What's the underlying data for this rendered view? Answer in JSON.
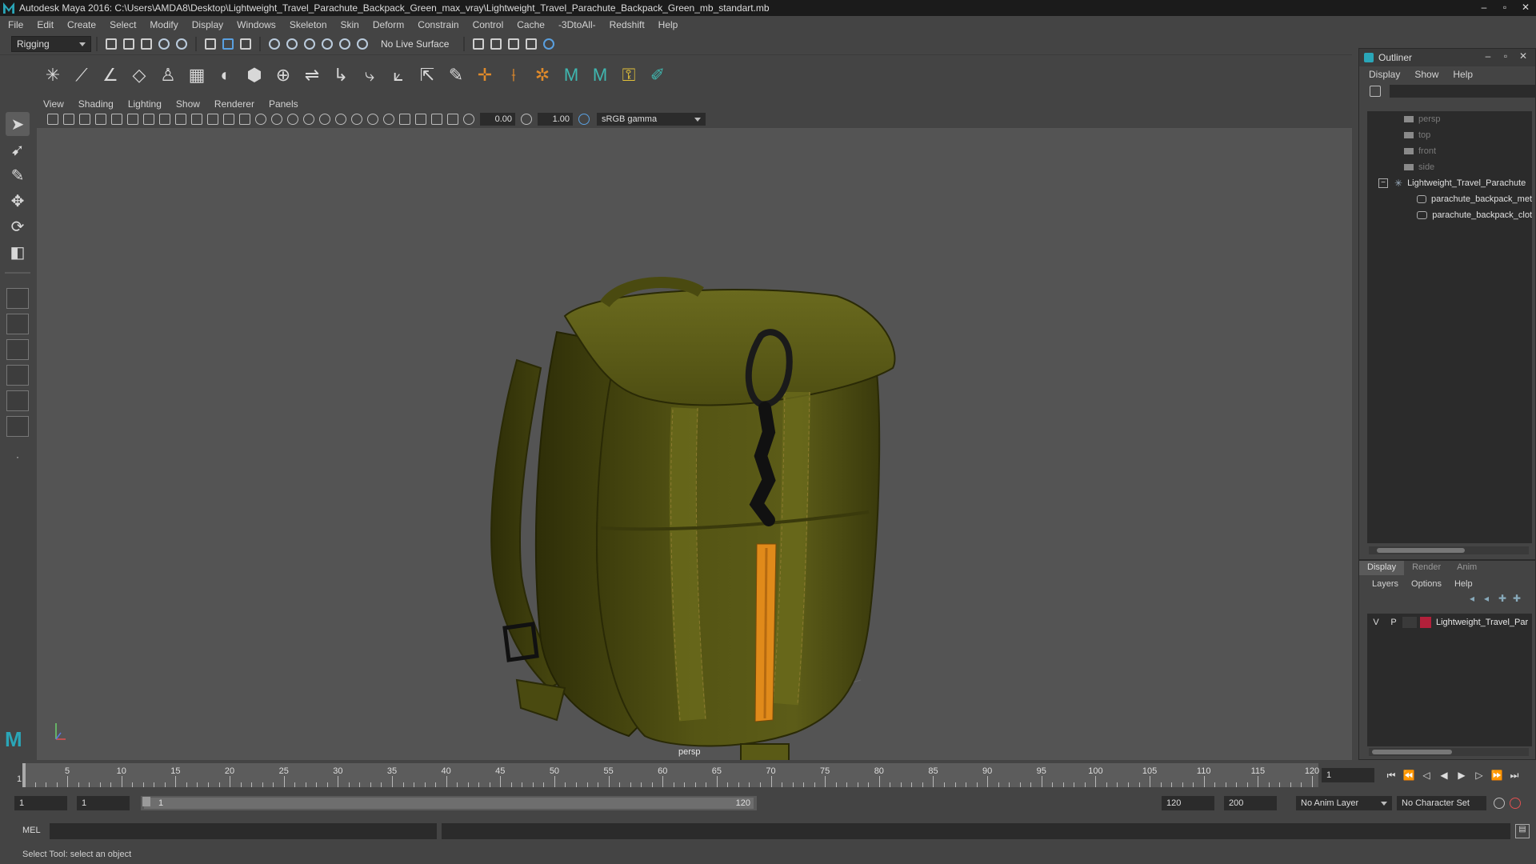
{
  "window": {
    "title": "Autodesk Maya 2016: C:\\Users\\AMDA8\\Desktop\\Lightweight_Travel_Parachute_Backpack_Green_max_vray\\Lightweight_Travel_Parachute_Backpack_Green_mb_standart.mb",
    "buttons": [
      "–",
      "▫",
      "✕"
    ]
  },
  "menubar": [
    "File",
    "Edit",
    "Create",
    "Select",
    "Modify",
    "Display",
    "Windows",
    "Skeleton",
    "Skin",
    "Deform",
    "Constrain",
    "Control",
    "Cache",
    "-3DtoAll-",
    "Redshift",
    "Help"
  ],
  "statusline": {
    "menuset": "Rigging",
    "live_surface": "No Live Surface"
  },
  "panel": {
    "menu": [
      "View",
      "Shading",
      "Lighting",
      "Show",
      "Renderer",
      "Panels"
    ],
    "exposure": "0.00",
    "gamma_value": "1.00",
    "color_space": "sRGB gamma",
    "camera": "persp"
  },
  "outliner": {
    "title": "Outliner",
    "menu": [
      "Display",
      "Show",
      "Help"
    ],
    "cameras": [
      "persp",
      "top",
      "front",
      "side"
    ],
    "group": "Lightweight_Travel_Parachute",
    "group_expander": "−",
    "children": [
      "parachute_backpack_met",
      "parachute_backpack_clot"
    ]
  },
  "layer_editor": {
    "tabs": [
      "Display",
      "Render",
      "Anim"
    ],
    "menu": [
      "Layers",
      "Options",
      "Help"
    ],
    "layer": {
      "v": "V",
      "p": "P",
      "name": "Lightweight_Travel_Par",
      "color": "#b2203a"
    }
  },
  "timeline": {
    "ticks": [
      "5",
      "10",
      "15",
      "20",
      "25",
      "30",
      "35",
      "40",
      "45",
      "50",
      "55",
      "60",
      "65",
      "70",
      "75",
      "80",
      "85",
      "90",
      "95",
      "100",
      "105",
      "110",
      "115",
      "120"
    ],
    "start": 1,
    "end": 120,
    "current_frame_label": "1",
    "current_frame": "1"
  },
  "range": {
    "start": "1",
    "anim_start": "1",
    "range_start_label": "1",
    "range_end_label": "120",
    "end": "120",
    "anim_end": "200",
    "anim_layer": "No Anim Layer",
    "character_set": "No Character Set"
  },
  "command": {
    "lang": "MEL"
  },
  "helpline": "Select Tool: select an object",
  "colors": {
    "maya_teal": "#2aa6b8",
    "backpack_green": "#5a5a16",
    "tag_orange": "#e08a1a",
    "layer_red": "#b2203a"
  }
}
